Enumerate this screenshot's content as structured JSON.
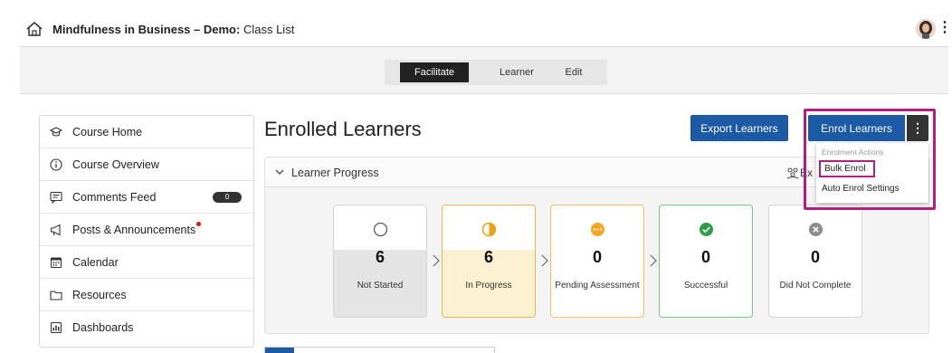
{
  "header": {
    "course_title": "Mindfulness in Business – Demo:",
    "page_name": "Class List"
  },
  "tabs": [
    "Facilitate",
    "Learner",
    "Edit"
  ],
  "sidebar": {
    "items": [
      {
        "label": "Course Home",
        "icon": "graduation-cap-icon"
      },
      {
        "label": "Course Overview",
        "icon": "info-icon"
      },
      {
        "label": "Comments Feed",
        "icon": "comments-icon",
        "badge": "0"
      },
      {
        "label": "Posts & Announcements",
        "icon": "megaphone-icon"
      },
      {
        "label": "Calendar",
        "icon": "calendar-icon"
      },
      {
        "label": "Resources",
        "icon": "folder-icon"
      },
      {
        "label": "Dashboards",
        "icon": "dashboard-icon"
      }
    ]
  },
  "main": {
    "heading": "Enrolled Learners",
    "export_button": "Export Learners",
    "enrol_button": "Enrol Learners"
  },
  "enrol_menu": {
    "header": "Enrolment Actions",
    "items": [
      "Bulk Enrol",
      "Auto Enrol Settings"
    ]
  },
  "progress": {
    "title": "Learner Progress",
    "expand_label": "Ex",
    "cards": [
      {
        "value": "6",
        "label": "Not Started",
        "icon": "empty-circle-icon"
      },
      {
        "value": "6",
        "label": "In Progress",
        "icon": "half-circle-icon"
      },
      {
        "value": "0",
        "label": "Pending Assessment",
        "icon": "pending-dots-icon"
      },
      {
        "value": "0",
        "label": "Successful",
        "icon": "check-circle-icon"
      },
      {
        "value": "0",
        "label": "Did Not Complete",
        "icon": "x-circle-icon"
      }
    ]
  },
  "colors": {
    "primary_blue": "#1c5aa6",
    "highlight_magenta": "#b01e7e",
    "in_progress": "#e8a317",
    "pending": "#f5a623",
    "successful": "#2e9e46",
    "did_not_complete": "#8c8c8c"
  }
}
